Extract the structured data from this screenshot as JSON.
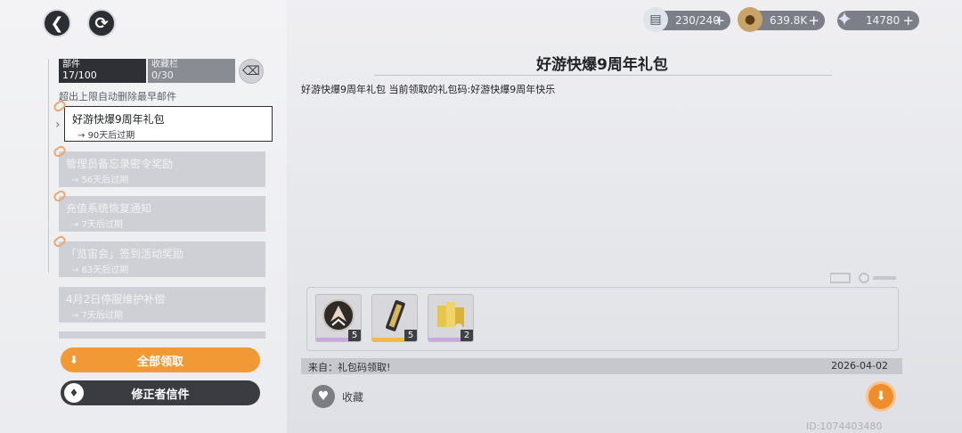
{
  "colors": {
    "accent": "#f19a35",
    "dark": "#2e3036"
  },
  "top_buttons": {
    "back_icon": "back-arrow-icon",
    "refresh_icon": "refresh-icon"
  },
  "resources": [
    {
      "icon": "stamina-icon",
      "value": "230/240",
      "plus": "+"
    },
    {
      "icon": "coin-icon",
      "value": "639.8K",
      "plus": "+"
    },
    {
      "icon": "star-crystal-icon",
      "value": "14780",
      "plus": "+"
    }
  ],
  "tabs": {
    "mail": {
      "label": "部件",
      "count": "17/100"
    },
    "favorites": {
      "label": "收藏栏",
      "count": "0/30"
    }
  },
  "hint": "超出上限自动删除最早邮件",
  "mails": [
    {
      "title": "好游快爆9周年礼包",
      "expire": "90天后过期"
    },
    {
      "title": "管理员备忘录密令奖励",
      "expire": "56天后过期"
    },
    {
      "title": "充值系统恢复通知",
      "expire": "7天后过期"
    },
    {
      "title": "「览宙会」签到活动奖励",
      "expire": "63天后过期"
    },
    {
      "title": "4月2日停服维护补偿",
      "expire": "7天后过期"
    }
  ],
  "buttons": {
    "claim_all": "全部领取",
    "letters": "修正者信件"
  },
  "detail": {
    "title": "好游快爆9周年礼包",
    "body": "好游快爆9周年礼包  当前领取的礼包码:好游快爆9周年快乐",
    "from": "来自：礼包码领取!",
    "date": "2026-04-02",
    "favorite": "收藏"
  },
  "attachments": [
    {
      "name": "emblem-item",
      "qty": "5",
      "rarity_color": "#c9a7e0"
    },
    {
      "name": "ticket-item",
      "qty": "5",
      "rarity_color": "#f0b94a"
    },
    {
      "name": "gold-stack-item",
      "qty": "2",
      "rarity_color": "#c9a7e0"
    }
  ],
  "uid": "ID:1074403480"
}
